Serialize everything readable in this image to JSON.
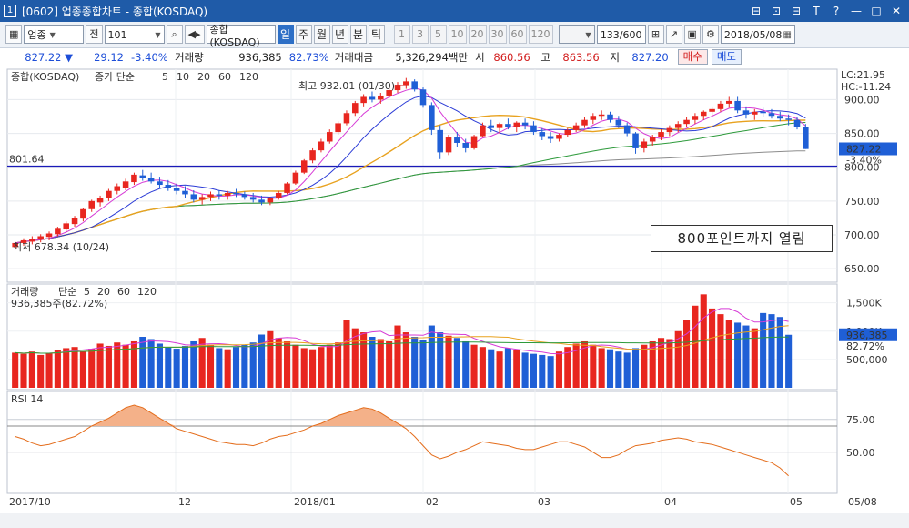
{
  "window": {
    "number": "1",
    "title": "[0602] 업종종합차트 - 종합(KOSDAQ)",
    "controls": [
      "⊟",
      "⊡",
      "⊟",
      "T",
      "?",
      "—",
      "□",
      "✕"
    ]
  },
  "toolbar": {
    "market": "업종",
    "prev_label": "전",
    "code": "101",
    "index_name": "종합(KOSDAQ)",
    "periods": [
      "일",
      "주",
      "월",
      "년",
      "분",
      "틱"
    ],
    "active_period": "일",
    "minute_nums": [
      "1",
      "3",
      "5",
      "10",
      "20",
      "30",
      "60",
      "120"
    ],
    "count": "133",
    "count_total": "/600",
    "date": "2018/05/08"
  },
  "infobar": {
    "price": "827.22",
    "change": "29.12",
    "change_pct": "-3.40%",
    "volume_label": "거래량",
    "volume": "936,385",
    "volume_pct": "82.73%",
    "amount_label": "거래대금",
    "amount": "5,326,294백만",
    "open_label": "시",
    "open": "860.56",
    "high_label": "고",
    "high": "863.56",
    "low_label": "저",
    "low": "827.20",
    "buy_label": "매수",
    "sell_label": "매도"
  },
  "price_panel": {
    "legend_name": "종합(KOSDAQ)",
    "ma_label": "종가 단순",
    "ma_periods": [
      "5",
      "10",
      "20",
      "60",
      "120"
    ],
    "lc": "LC:21.95",
    "hc": "HC:-11.24",
    "y_ticks": [
      "900.00",
      "850.00",
      "800.00",
      "750.00",
      "700.00",
      "650.00"
    ],
    "hline_label": "801.64",
    "last_price": "827.22",
    "last_pct": "-3.40%",
    "high_note": "최고 932.01 (01/30)",
    "low_note": "최저 678.34 (10/24)",
    "annotation": "800포인트까지  열림"
  },
  "volume_panel": {
    "title": "거래량",
    "ma_label": "단순",
    "ma_periods": [
      "5",
      "20",
      "60",
      "120"
    ],
    "summary": "936,385주(82.72%)",
    "y_ticks": [
      "1,500K",
      "1,000K",
      "500,000"
    ],
    "last": "936,385",
    "last_pct": "82.72%"
  },
  "rsi_panel": {
    "title": "RSI 14",
    "y_ticks": [
      "75.00",
      "50.00"
    ]
  },
  "x_axis": {
    "labels": [
      "2017/10",
      "12",
      "2018/01",
      "02",
      "03",
      "04",
      "05",
      "05/08"
    ]
  },
  "colors": {
    "up": "#e8261f",
    "down": "#1f5fd6",
    "ma5": "#d63bd6",
    "ma10": "#2b3bd6",
    "ma20": "#e8a21f",
    "ma60": "#2d9a3b",
    "ma120": "#8d8d8d",
    "rsi": "#e46d1c",
    "hline": "#1a1ab8"
  },
  "chart_data": {
    "type": "candlestick",
    "ohlc": [
      [
        682,
        690,
        678,
        688
      ],
      [
        688,
        695,
        684,
        692
      ],
      [
        690,
        698,
        686,
        694
      ],
      [
        693,
        701,
        689,
        698
      ],
      [
        697,
        705,
        692,
        702
      ],
      [
        701,
        712,
        698,
        709
      ],
      [
        708,
        720,
        704,
        717
      ],
      [
        716,
        728,
        712,
        725
      ],
      [
        724,
        740,
        720,
        738
      ],
      [
        738,
        752,
        734,
        750
      ],
      [
        748,
        758,
        742,
        755
      ],
      [
        754,
        768,
        750,
        765
      ],
      [
        765,
        776,
        760,
        772
      ],
      [
        770,
        783,
        766,
        779
      ],
      [
        778,
        792,
        774,
        789
      ],
      [
        788,
        796,
        780,
        784
      ],
      [
        784,
        792,
        776,
        779
      ],
      [
        779,
        786,
        770,
        774
      ],
      [
        774,
        781,
        765,
        769
      ],
      [
        769,
        776,
        760,
        765
      ],
      [
        765,
        772,
        755,
        760
      ],
      [
        760,
        766,
        748,
        752
      ],
      [
        752,
        760,
        745,
        756
      ],
      [
        756,
        764,
        750,
        760
      ],
      [
        760,
        766,
        752,
        758
      ],
      [
        758,
        765,
        752,
        762
      ],
      [
        762,
        768,
        756,
        760
      ],
      [
        760,
        764,
        752,
        756
      ],
      [
        756,
        762,
        748,
        752
      ],
      [
        752,
        758,
        744,
        748
      ],
      [
        748,
        756,
        744,
        754
      ],
      [
        754,
        765,
        752,
        762
      ],
      [
        762,
        778,
        760,
        776
      ],
      [
        776,
        795,
        774,
        792
      ],
      [
        792,
        812,
        790,
        810
      ],
      [
        810,
        828,
        806,
        825
      ],
      [
        825,
        842,
        822,
        838
      ],
      [
        838,
        856,
        835,
        852
      ],
      [
        852,
        868,
        848,
        865
      ],
      [
        865,
        884,
        862,
        880
      ],
      [
        880,
        898,
        876,
        895
      ],
      [
        895,
        908,
        890,
        904
      ],
      [
        904,
        912,
        896,
        900
      ],
      [
        900,
        910,
        894,
        906
      ],
      [
        906,
        918,
        902,
        914
      ],
      [
        914,
        926,
        910,
        922
      ],
      [
        922,
        932,
        916,
        927
      ],
      [
        927,
        930,
        912,
        915
      ],
      [
        915,
        918,
        888,
        892
      ],
      [
        892,
        896,
        848,
        855
      ],
      [
        855,
        862,
        812,
        822
      ],
      [
        822,
        848,
        818,
        844
      ],
      [
        844,
        852,
        830,
        836
      ],
      [
        836,
        842,
        822,
        828
      ],
      [
        828,
        848,
        826,
        846
      ],
      [
        846,
        866,
        844,
        862
      ],
      [
        862,
        870,
        852,
        858
      ],
      [
        858,
        866,
        850,
        864
      ],
      [
        864,
        872,
        856,
        860
      ],
      [
        860,
        868,
        852,
        866
      ],
      [
        866,
        872,
        856,
        862
      ],
      [
        862,
        868,
        848,
        852
      ],
      [
        852,
        858,
        840,
        846
      ],
      [
        846,
        852,
        836,
        842
      ],
      [
        842,
        850,
        838,
        848
      ],
      [
        848,
        858,
        844,
        855
      ],
      [
        855,
        866,
        852,
        862
      ],
      [
        862,
        874,
        858,
        870
      ],
      [
        870,
        880,
        864,
        876
      ],
      [
        876,
        884,
        870,
        878
      ],
      [
        878,
        882,
        866,
        870
      ],
      [
        870,
        876,
        858,
        862
      ],
      [
        862,
        866,
        846,
        850
      ],
      [
        850,
        852,
        820,
        828
      ],
      [
        828,
        842,
        822,
        838
      ],
      [
        838,
        848,
        832,
        844
      ],
      [
        844,
        856,
        840,
        852
      ],
      [
        852,
        862,
        846,
        858
      ],
      [
        858,
        868,
        852,
        864
      ],
      [
        864,
        874,
        860,
        870
      ],
      [
        870,
        880,
        864,
        876
      ],
      [
        876,
        884,
        870,
        882
      ],
      [
        882,
        890,
        876,
        886
      ],
      [
        886,
        898,
        882,
        894
      ],
      [
        894,
        904,
        888,
        898
      ],
      [
        898,
        904,
        880,
        884
      ],
      [
        884,
        890,
        872,
        878
      ],
      [
        878,
        886,
        870,
        882
      ],
      [
        882,
        888,
        874,
        880
      ],
      [
        880,
        886,
        872,
        876
      ],
      [
        876,
        882,
        868,
        872
      ],
      [
        872,
        878,
        862,
        870
      ],
      [
        870,
        874,
        856,
        860
      ],
      [
        860,
        864,
        827,
        827
      ]
    ],
    "volume": [
      620,
      600,
      640,
      580,
      610,
      660,
      700,
      720,
      650,
      690,
      780,
      740,
      800,
      760,
      820,
      900,
      860,
      780,
      720,
      690,
      740,
      820,
      880,
      760,
      700,
      680,
      720,
      760,
      800,
      940,
      1000,
      880,
      820,
      760,
      700,
      680,
      720,
      760,
      800,
      1200,
      1050,
      980,
      900,
      860,
      820,
      1100,
      980,
      900,
      840,
      1100,
      980,
      920,
      880,
      820,
      760,
      720,
      680,
      640,
      700,
      660,
      620,
      600,
      580,
      560,
      640,
      720,
      780,
      820,
      760,
      700,
      680,
      640,
      620,
      700,
      760,
      820,
      880,
      860,
      1000,
      1200,
      1450,
      1650,
      1400,
      1300,
      1200,
      1150,
      1100,
      1050,
      1320,
      1300,
      1250,
      936
    ],
    "rsi": [
      62,
      60,
      57,
      55,
      56,
      58,
      60,
      62,
      66,
      70,
      73,
      76,
      80,
      84,
      86,
      84,
      80,
      76,
      72,
      68,
      66,
      64,
      62,
      60,
      58,
      57,
      56,
      56,
      55,
      57,
      60,
      62,
      63,
      65,
      67,
      70,
      72,
      75,
      78,
      80,
      82,
      84,
      83,
      80,
      76,
      72,
      68,
      62,
      55,
      48,
      45,
      47,
      50,
      52,
      55,
      58,
      57,
      56,
      55,
      53,
      52,
      52,
      54,
      56,
      58,
      58,
      56,
      54,
      50,
      46,
      46,
      48,
      52,
      55,
      56,
      57,
      59,
      60,
      61,
      60,
      58,
      57,
      56,
      54,
      52,
      50,
      48,
      46,
      44,
      42,
      38,
      32
    ]
  }
}
